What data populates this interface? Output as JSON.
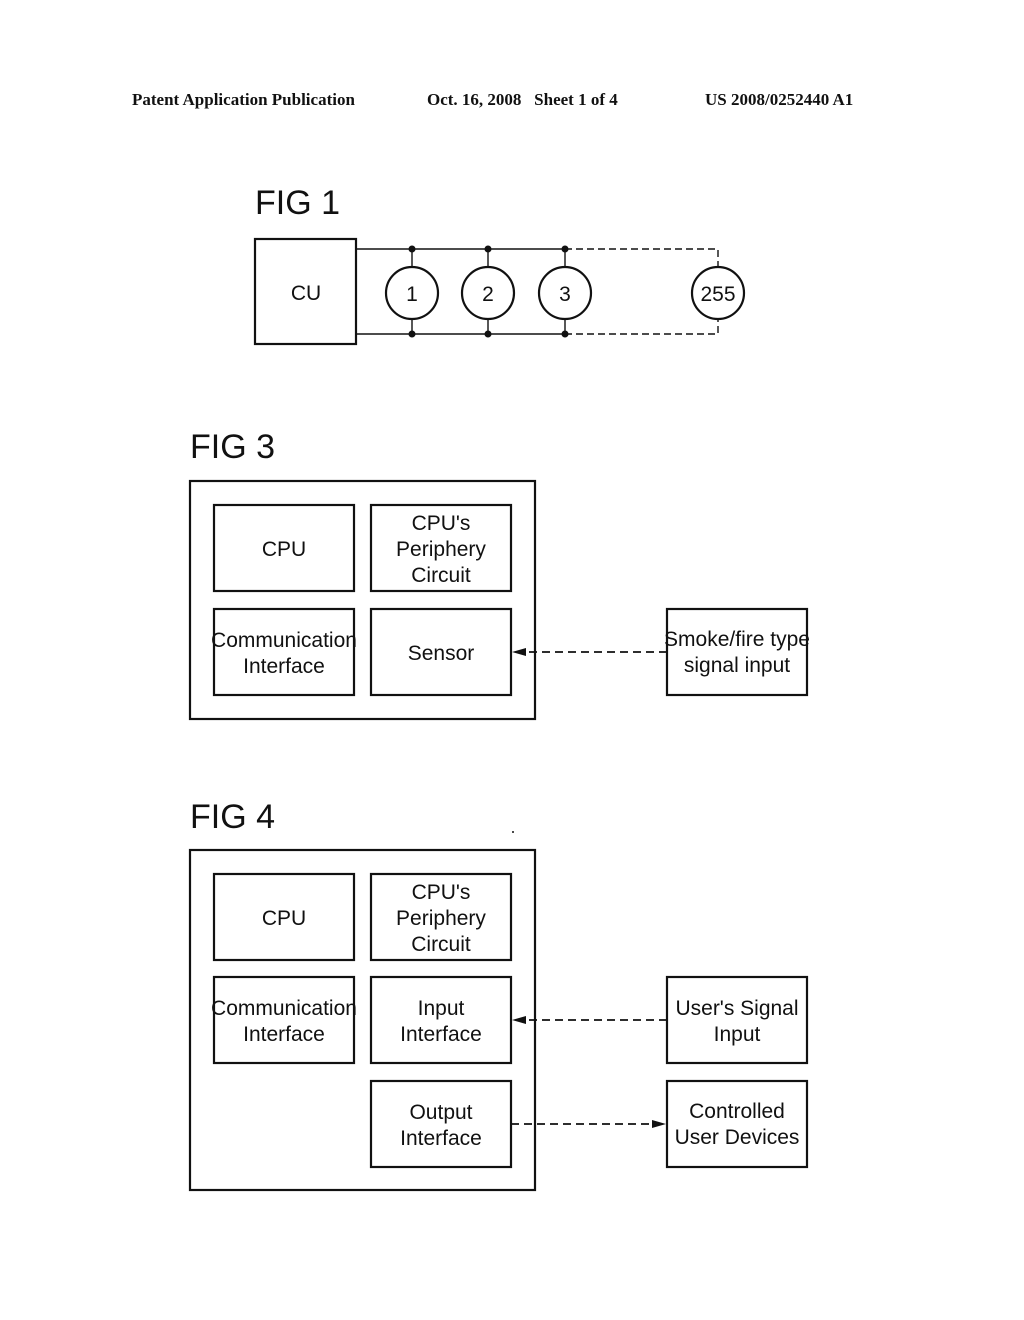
{
  "header": {
    "publication": "Patent Application Publication",
    "date_sheet": "Oct. 16, 2008   Sheet 1 of 4",
    "number": "US 2008/0252440 A1"
  },
  "fig1": {
    "title": "FIG 1",
    "control_unit": "CU",
    "nodes": [
      "1",
      "2",
      "3",
      "255"
    ]
  },
  "fig3": {
    "title": "FIG 3",
    "blocks": {
      "cpu": [
        "CPU"
      ],
      "periphery": [
        "CPU's",
        "Periphery",
        "Circuit"
      ],
      "comm": [
        "Communication",
        "Interface"
      ],
      "sensor": [
        "Sensor"
      ]
    },
    "external": [
      "Smoke/fire type",
      "signal input"
    ]
  },
  "fig4": {
    "title": "FIG 4",
    "blocks": {
      "cpu": [
        "CPU"
      ],
      "periphery": [
        "CPU's",
        "Periphery",
        "Circuit"
      ],
      "comm": [
        "Communication",
        "Interface"
      ],
      "input": [
        "Input",
        "Interface"
      ],
      "output": [
        "Output",
        "Interface"
      ]
    },
    "external_input": [
      "User's Signal",
      "Input"
    ],
    "external_output": [
      "Controlled",
      "User Devices"
    ]
  }
}
